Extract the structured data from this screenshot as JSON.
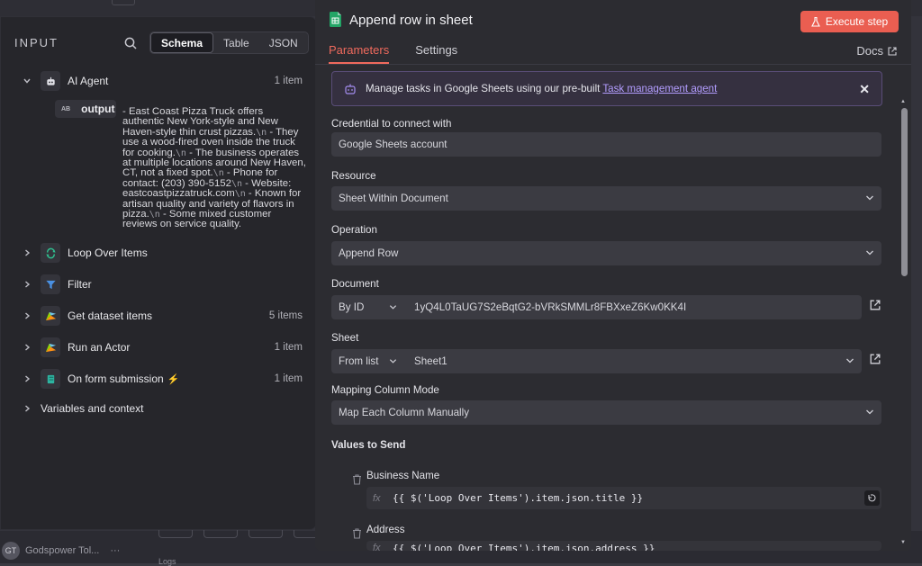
{
  "input_panel": {
    "title": "INPUT",
    "tabs": [
      "Schema",
      "Table",
      "JSON"
    ],
    "nodes": [
      {
        "label": "AI Agent",
        "count": "1 item",
        "icon": "robot-icon"
      },
      {
        "label": "Loop Over Items",
        "count": "",
        "icon": "loop-icon"
      },
      {
        "label": "Filter",
        "count": "",
        "icon": "filter-icon"
      },
      {
        "label": "Get dataset items",
        "count": "5 items",
        "icon": "apify-icon"
      },
      {
        "label": "Run an Actor",
        "count": "1 item",
        "icon": "apify-icon"
      },
      {
        "label": "On form submission",
        "count": "1 item",
        "icon": "form-icon"
      }
    ],
    "output": {
      "type_badge": "AB",
      "label": "output",
      "value_parts": [
        "- East Coast Pizza Truck offers authentic New York-style and New Haven-style thin crust pizzas.",
        "\\n",
        " - They use a wood-fired oven inside the truck for cooking.",
        "\\n",
        " - The business operates at multiple locations around New Haven, CT, not a fixed spot.",
        "\\n",
        " - Phone for contact: (203) 390-5152",
        "\\n",
        " - Website: eastcoastpizzatruck.com",
        "\\n",
        " - Known for artisan quality and variety of flavors in pizza.",
        "\\n",
        " - Some mixed customer reviews on service quality."
      ]
    },
    "variables_label": "Variables and context"
  },
  "background": {
    "user_initials": "GT",
    "user_name": "Godspower Tol...",
    "user_menu": "···",
    "bottom_text": "Logs"
  },
  "node_panel": {
    "title": "Append row in sheet",
    "execute_label": "Execute step",
    "tabs": [
      "Parameters",
      "Settings"
    ],
    "docs_label": "Docs",
    "banner": {
      "text": "Manage tasks in Google Sheets using our pre-built",
      "link": "Task management agent"
    },
    "credential": {
      "label": "Credential to connect with",
      "value": "Google Sheets account"
    },
    "resource": {
      "label": "Resource",
      "value": "Sheet Within Document"
    },
    "operation": {
      "label": "Operation",
      "value": "Append Row"
    },
    "document": {
      "label": "Document",
      "mode": "By ID",
      "value": "1yQ4L0TaUG7S2eBqtG2-bVRkSMMLr8FBXxeZ6Kw0KK4I"
    },
    "sheet": {
      "label": "Sheet",
      "mode": "From list",
      "value": "Sheet1"
    },
    "mapping": {
      "label": "Mapping Column Mode",
      "value": "Map Each Column Manually"
    },
    "values_label": "Values to Send",
    "values": [
      {
        "name": "Business Name",
        "expression": "{{ $('Loop Over Items').item.json.title }}"
      },
      {
        "name": "Address",
        "expression": "{{ $('Loop Over Items').item.json.address }}"
      }
    ]
  },
  "colors": {
    "accent": "#ea5e51",
    "tab_active": "#ef6a5d",
    "link": "#b39dff",
    "sheets_green": "#23a566"
  }
}
